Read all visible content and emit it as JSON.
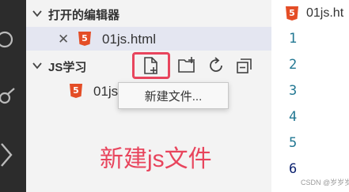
{
  "sidebar": {
    "open_editors": {
      "title": "打开的编辑器",
      "files": [
        {
          "name": "01js.html",
          "icon": "html5-icon",
          "badge": "5"
        }
      ]
    },
    "workspace": {
      "title": "JS学习",
      "toolbar": [
        {
          "name": "new-file-icon",
          "highlighted": true
        },
        {
          "name": "new-folder-icon",
          "highlighted": false
        },
        {
          "name": "refresh-icon",
          "highlighted": false
        },
        {
          "name": "collapse-all-icon",
          "highlighted": false
        }
      ],
      "files": [
        {
          "name": "01js.html",
          "visible_text": "01js",
          "icon": "html5-icon",
          "badge": "5"
        }
      ]
    },
    "tooltip": "新建文件..."
  },
  "annotation": "新建js文件",
  "editor": {
    "tab_label": "01js.ht",
    "tab_badge": "5",
    "line_numbers": [
      "1",
      "2",
      "3",
      "4",
      "5",
      "6"
    ]
  },
  "watermark": "CSDN @岁岁岁平安",
  "colors": {
    "activity_bar": "#2c2c2c",
    "sidebar_bg": "#f3f3f3",
    "selected_row": "#e4e6f1",
    "html5_orange": "#e44d26",
    "highlight_red": "#e8455d",
    "line_number": "#237893"
  }
}
